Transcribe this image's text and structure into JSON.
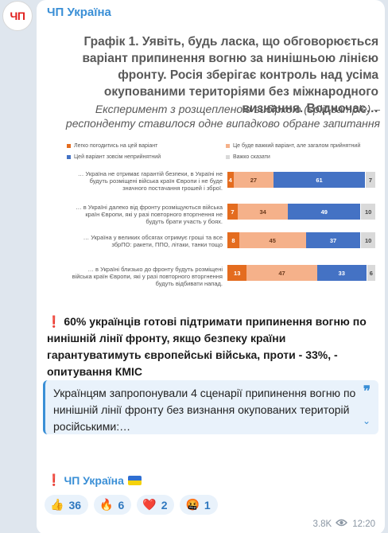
{
  "avatar": {
    "text": "ЧП"
  },
  "channel": {
    "name": "ЧП Україна"
  },
  "graphic": {
    "title": "Графік 1. Уявіть, будь ласка, що обговорюється варіант припинення вогню за нинішньою лінією фронту. Росія зберігає контроль над усіма окупованими територіями без міжнародного визнання. Водночас…",
    "subtitle": "Експеримент з розщепленою вибіркою (split-sample) – респонденту ставилося одне випадково обране запитання"
  },
  "chart_data": {
    "type": "bar",
    "stacked": "horizontal-100%",
    "categories": [
      "… Україна не отримає гарантій безпеки, в Україні не будуть розміщені війська країн Європи і не буде значного постачання грошей і зброї.",
      "… в Україні далеко від фронту розміщуються війська країн Європи, які у разі повторного вторгнення не будуть брати участь у боях.",
      "… Україна у великих обсягах отримує гроші та все збрПО: ракети, ППО, літаки, танки тощо",
      "… в Україні близько до фронту будуть розміщені війська країн Європи, які у разі повторного вторгнення будуть відбивати напад."
    ],
    "series": [
      {
        "name": "Легко погодитись на цей варіант",
        "color": "#e46c1f",
        "values": [
          4,
          7,
          8,
          13
        ]
      },
      {
        "name": "Це буде важкий варіант, але загалом прийнятний",
        "color": "#f5b18a",
        "values": [
          27,
          34,
          45,
          47
        ]
      },
      {
        "name": "Цей варіант зовсім неприйнятний",
        "color": "#4472c4",
        "values": [
          61,
          49,
          37,
          33
        ]
      },
      {
        "name": "Важко сказати",
        "color": "#d9d9d9",
        "values": [
          7,
          10,
          10,
          6
        ]
      }
    ]
  },
  "post": {
    "mark": "❗",
    "text": "60% українців готові підтримати припинення вогню по нинішній лінії фронту, якщо безпеку країни гарантуватимуть європейські війська, проти - 33%, - опитування КМІС"
  },
  "quote": {
    "text": "Українцям запропонували 4 сценарії припинення вогню по нинішній лінії фронту без визнання окупованих територій російськими:…",
    "mark": "❞",
    "chevron": "⌄"
  },
  "signature": {
    "mark": "❗",
    "text": "ЧП Україна"
  },
  "reactions": [
    {
      "emoji": "👍",
      "count": "36"
    },
    {
      "emoji": "🔥",
      "count": "6"
    },
    {
      "emoji": "❤️",
      "count": "2"
    },
    {
      "emoji": "🤬",
      "count": "1"
    }
  ],
  "meta": {
    "views": "3.8K",
    "time": "12:20"
  }
}
